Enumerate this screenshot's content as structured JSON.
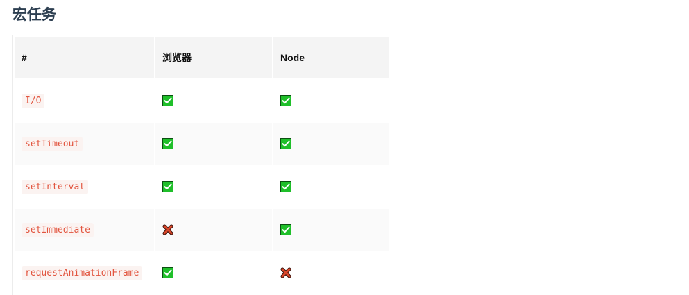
{
  "title": "宏任务",
  "table": {
    "headers": [
      "#",
      "浏览器",
      "Node"
    ],
    "rows": [
      {
        "name": "I/O",
        "browser": "check-icon",
        "node": "check-icon"
      },
      {
        "name": "setTimeout",
        "browser": "check-icon",
        "node": "check-icon"
      },
      {
        "name": "setInterval",
        "browser": "check-icon",
        "node": "check-icon"
      },
      {
        "name": "setImmediate",
        "browser": "cross-icon",
        "node": "check-icon"
      },
      {
        "name": "requestAnimationFrame",
        "browser": "check-icon",
        "node": "cross-icon"
      }
    ]
  },
  "colors": {
    "code_text": "#e2553f",
    "check_green": "#1fbf2a",
    "cross_red": "#d9472b"
  }
}
